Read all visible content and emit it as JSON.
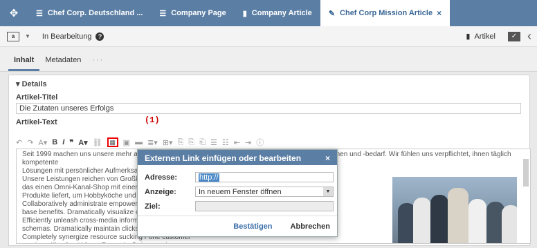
{
  "tabs": [
    {
      "label": "Chef Corp. Deutschland ...",
      "icon": "list-icon"
    },
    {
      "label": "Company Page",
      "icon": "list-icon"
    },
    {
      "label": "Company Article",
      "icon": "document-icon"
    },
    {
      "label": "Chef Corp Mission Article",
      "icon": "pencil-icon"
    }
  ],
  "toolbar": {
    "status": "In Bearbeitung",
    "artikel": "Artikel"
  },
  "subtabs": {
    "inhalt": "Inhalt",
    "metadaten": "Metadaten",
    "more": "···"
  },
  "details": {
    "heading": "Details",
    "title_label": "Artikel-Titel",
    "title_value": "Die Zutaten unseres Erfolgs",
    "text_label": "Artikel-Text",
    "annotation": "(1)"
  },
  "editor_lines": [
    "Seit 1999 machen uns unsere mehr als 1.000.000 Kunden zum führenden Anbieter von Restaurantküchen und -bedarf. Wir fühlen uns verpflichtet, ihnen täglich kompetente",
    "Lösungen mit persönlicher Aufmerksamkeit anzubieten.",
    "Unsere Leistungen reichen von Großküchen                                                                          Portal Perfect Chef,",
    "das einen Omni-Kanal-Shop mit einer Kun                                                                        handverlesene",
    "Produkte liefert, um Hobbyköche und Ge",
    "Collaboratively administrate empowered                                                                    sers after installed",
    "base benefits. Dramatically visualize cus",
    "Efficiently unleash cross-media informati                                                                  r real-time",
    "schemas. Dramatically maintain clicks-a",
    "Completely synergize resource sucking r                                                                     one customer",
    "service with robust ideas. Dynamically in                                                                    r service."
  ],
  "dialog": {
    "title": "Externen Link einfügen oder bearbeiten",
    "close": "×",
    "adresse_label": "Adresse:",
    "adresse_value": "http://",
    "anzeige_label": "Anzeige:",
    "anzeige_value": "In neuem Fenster öffnen",
    "ziel_label": "Ziel:",
    "confirm": "Bestätigen",
    "cancel": "Abbrechen"
  },
  "colors": {
    "accent": "#5b7ea4",
    "highlight": "#e00000"
  }
}
